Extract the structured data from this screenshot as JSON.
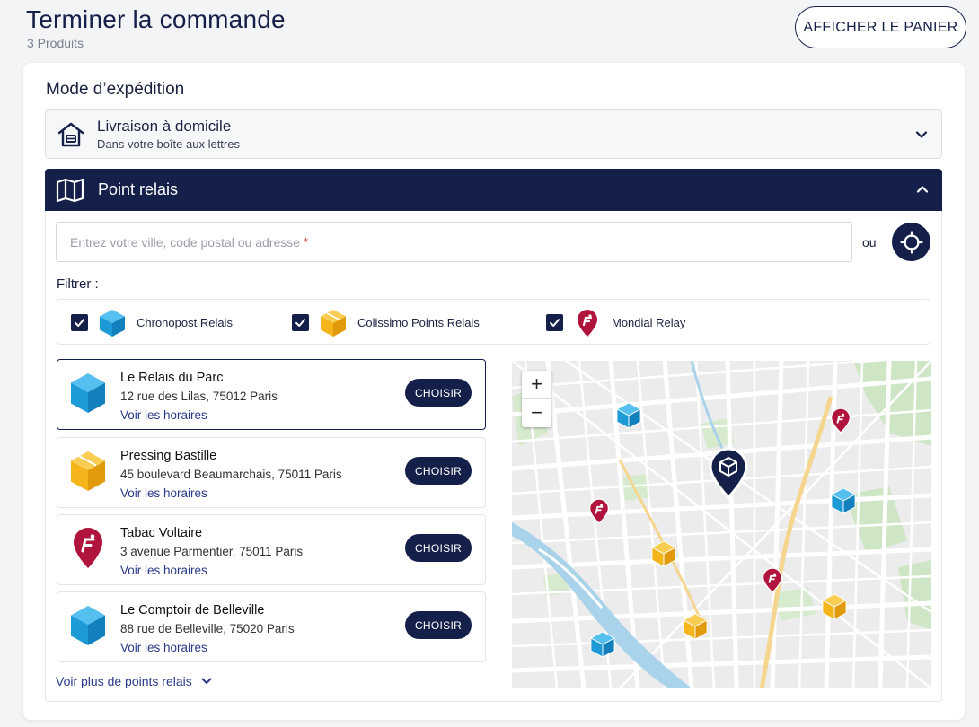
{
  "header": {
    "title": "Terminer la commande",
    "subtitle": "3 Produits",
    "cart_button": "AFFICHER LE PANIER"
  },
  "shipping": {
    "section_title": "Mode d’expédition",
    "home": {
      "title": "Livraison à domicile",
      "subtitle": "Dans votre boîte aux lettres",
      "icon": "house-icon"
    },
    "relay": {
      "title": "Point relais",
      "icon": "map-icon",
      "search_placeholder": "Entrez votre ville, code postal ou adresse",
      "required_mark": "*",
      "or_label": "ou",
      "filter_label": "Filtrer :",
      "filters": [
        {
          "label": "Chronopost Relais",
          "checked": true,
          "color": "#1e9ad6"
        },
        {
          "label": "Colissimo Points Relais",
          "checked": true,
          "color": "#f4b41a"
        },
        {
          "label": "Mondial Relay",
          "checked": true,
          "color": "#b0143c"
        }
      ],
      "points": [
        {
          "name": "Le Relais du Parc",
          "address": "12 rue des Lilas, 75012 Paris",
          "link": "Voir les horaires",
          "button": "CHOISIR",
          "carrier": "chronopost",
          "selected": true
        },
        {
          "name": "Pressing Bastille",
          "address": "45 boulevard Beaumarchais, 75011 Paris",
          "link": "Voir les horaires",
          "button": "CHOISIR",
          "carrier": "colissimo",
          "selected": false
        },
        {
          "name": "Tabac Voltaire",
          "address": "3 avenue Parmentier, 75011 Paris",
          "link": "Voir les horaires",
          "button": "CHOISIR",
          "carrier": "mondial",
          "selected": false
        },
        {
          "name": "Le Comptoir de Belleville",
          "address": "88 rue de Belleville, 75020 Paris",
          "link": "Voir les horaires",
          "button": "CHOISIR",
          "carrier": "chronopost",
          "selected": false
        }
      ],
      "more_link": "Voir plus de points relais",
      "map": {
        "zoom_in": "+",
        "zoom_out": "−"
      }
    }
  },
  "colors": {
    "navy": "#15204a",
    "chronopost": "#1e9ad6",
    "colissimo": "#f4b41a",
    "mondial": "#b0143c"
  }
}
